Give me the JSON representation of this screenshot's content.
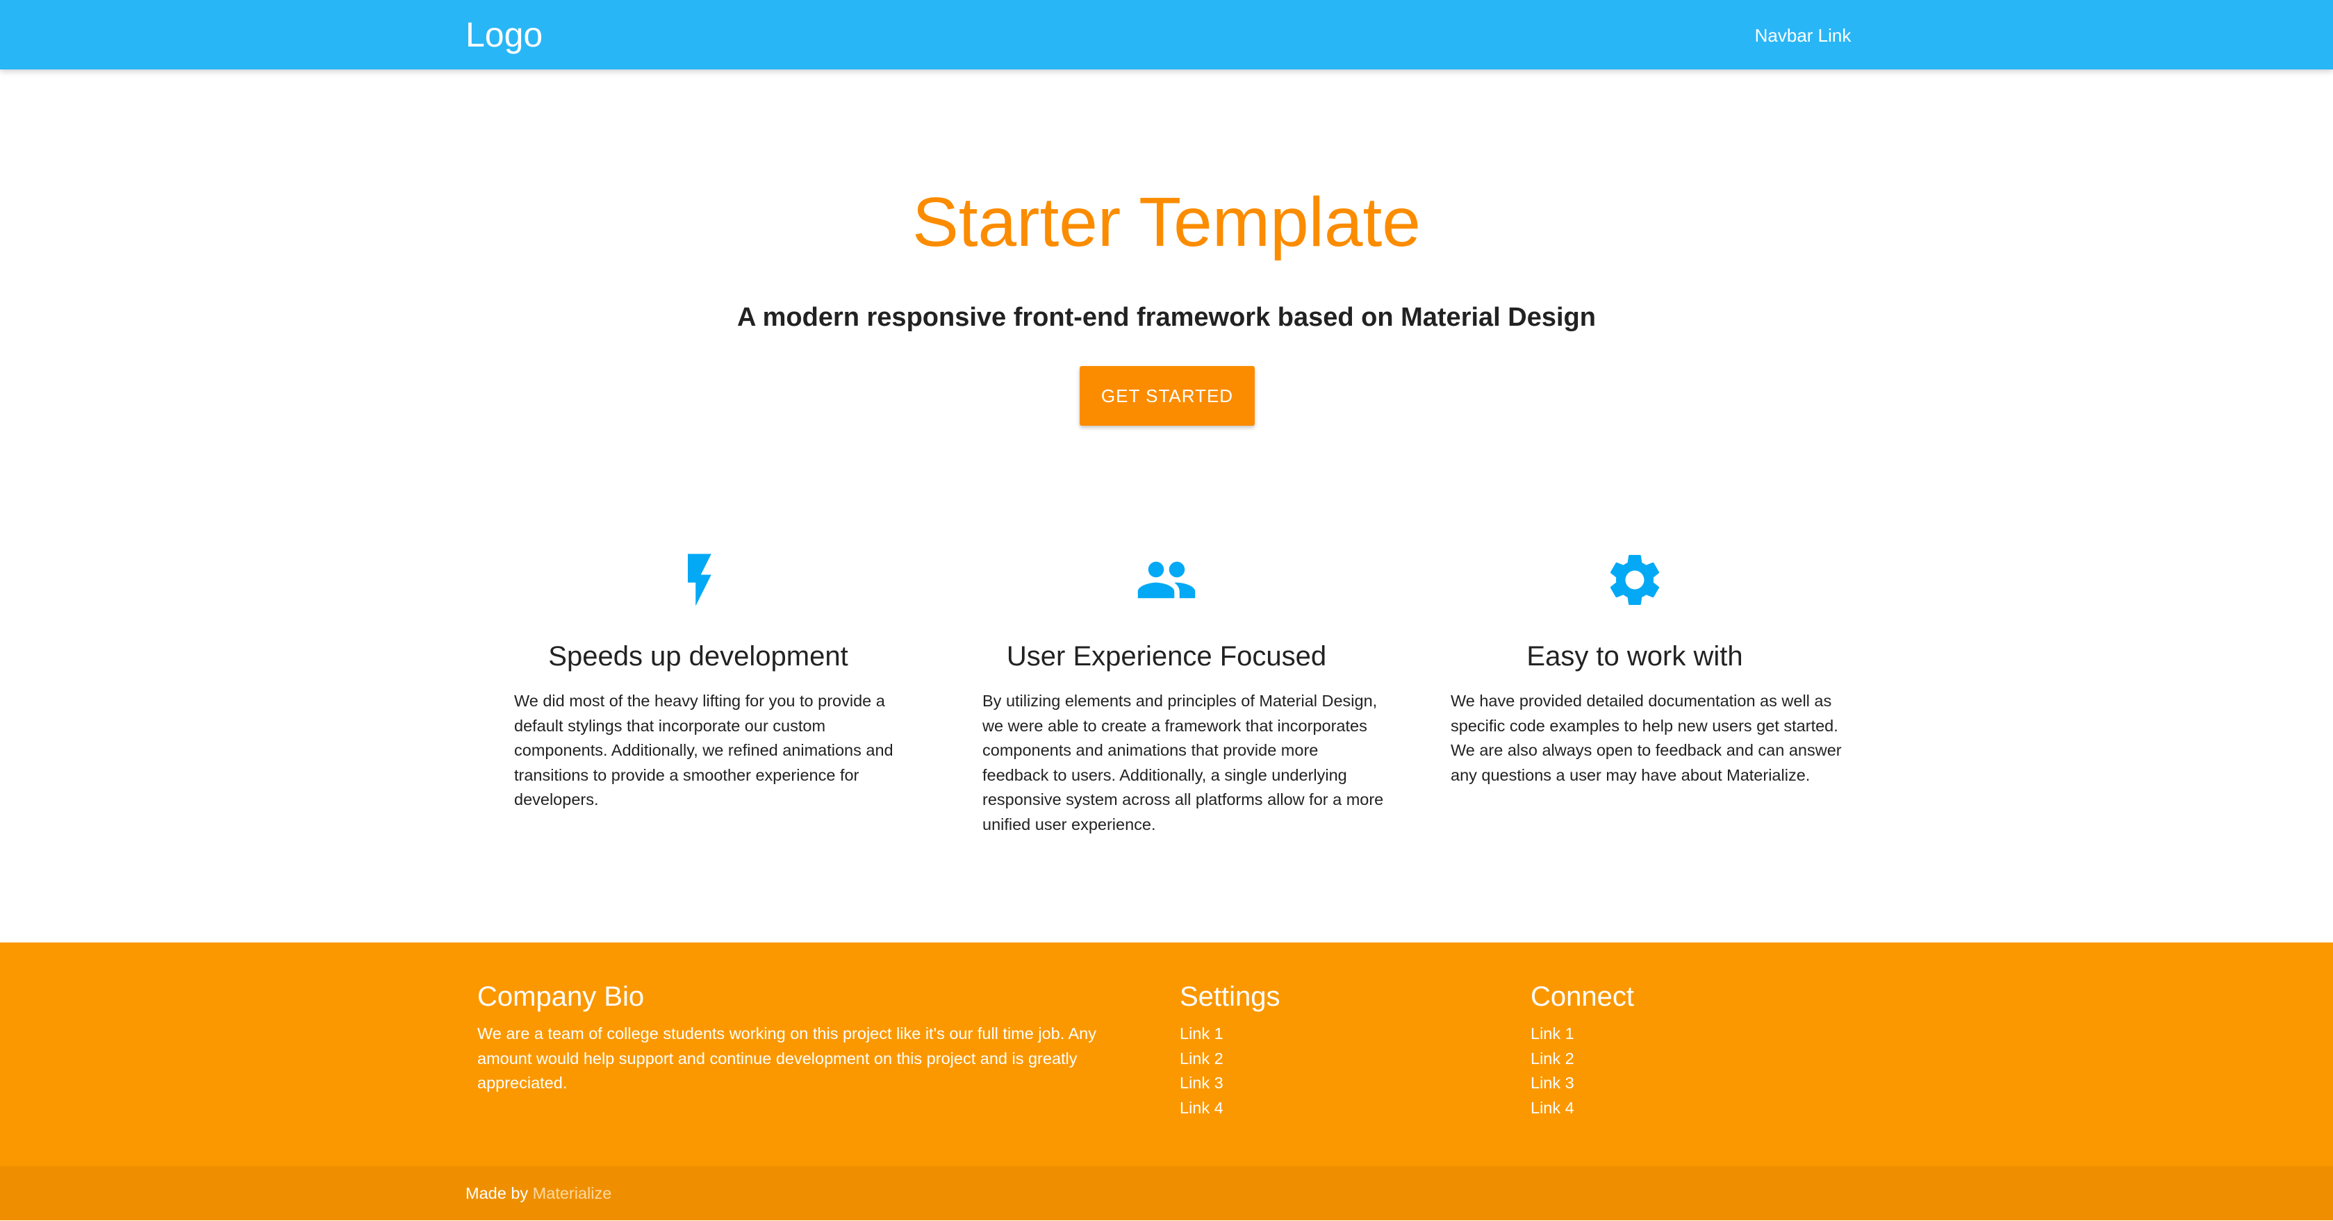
{
  "navbar": {
    "logo": "Logo",
    "link": "Navbar Link",
    "background": "#29b6f6"
  },
  "hero": {
    "title": "Starter Template",
    "subtitle": "A modern responsive front-end framework based on Material Design",
    "button_label": "GET STARTED",
    "accent": "#fb8c00"
  },
  "features": [
    {
      "icon": "flash-icon",
      "title": "Speeds up development",
      "text": "We did most of the heavy lifting for you to provide a default stylings that incorporate our custom components. Additionally, we refined animations and transitions to provide a smoother experience for developers."
    },
    {
      "icon": "group-icon",
      "title": "User Experience Focused",
      "text": "By utilizing elements and principles of Material Design, we were able to create a framework that incorporates components and animations that provide more feedback to users. Additionally, a single underlying responsive system across all platforms allow for a more unified user experience."
    },
    {
      "icon": "settings-icon",
      "title": "Easy to work with",
      "text": "We have provided detailed documentation as well as specific code examples to help new users get started. We are also always open to feedback and can answer any questions a user may have about Materialize."
    }
  ],
  "icon_color": "#03a9f4",
  "footer": {
    "bio_title": "Company Bio",
    "bio_text": "We are a team of college students working on this project like it's our full time job. Any amount would help support and continue development on this project and is greatly appreciated.",
    "settings_title": "Settings",
    "settings_links": [
      "Link 1",
      "Link 2",
      "Link 3",
      "Link 4"
    ],
    "connect_title": "Connect",
    "connect_links": [
      "Link 1",
      "Link 2",
      "Link 3",
      "Link 4"
    ],
    "background": "#fb9800"
  },
  "copyright": {
    "prefix": "Made by",
    "link": "Materialize"
  }
}
